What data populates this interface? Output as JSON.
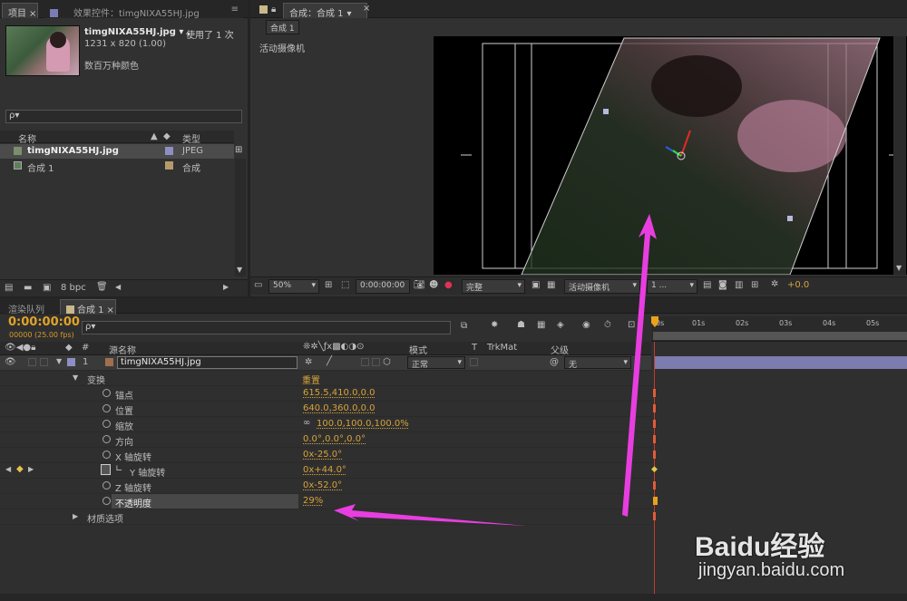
{
  "project": {
    "tabs": [
      "项目",
      "效果控件：timgNIXA55HJ.jpg"
    ],
    "asset_name": "timgNIXA55HJ.jpg ▾ ,",
    "usage": "使用了 1 次",
    "dims": "1231 x 820 (1.00)",
    "color_desc": "数百万种颜色",
    "search_placeholder": "ρ▾",
    "columns": {
      "name": "名称",
      "type": "类型"
    },
    "items": [
      {
        "name": "timgNIXA55HJ.jpg",
        "type": "JPEG",
        "swatch": "#8e8ec4"
      },
      {
        "name": "合成 1",
        "type": "合成",
        "swatch": "#b49a6a"
      }
    ],
    "bpc": "8 bpc"
  },
  "viewer": {
    "tab": "合成：合成 1",
    "subtab": "合成 1",
    "camera_label": "活动摄像机",
    "toolbar": {
      "zoom": "50%",
      "timecode": "0:00:00:00",
      "quality": "完整",
      "view": "活动摄像机",
      "layout": "1 ...",
      "exposure": "+0.0"
    }
  },
  "timeline": {
    "tabs": [
      "渲染队列",
      "合成 1"
    ],
    "timecode": "0:00:00:00",
    "fps": "00000 (25.00 fps)",
    "search_placeholder": "ρ▾",
    "headers": {
      "hash": "#",
      "source": "源名称",
      "mode": "模式",
      "t": "T",
      "trkmat": "TrkMat",
      "parent": "父级"
    },
    "layer": {
      "num": "1",
      "name": "timgNIXA55HJ.jpg",
      "mode": "正常",
      "parent": "无"
    },
    "transform_label": "变换",
    "reset_label": "重置",
    "props": [
      {
        "name": "锚点",
        "value": "615.5,410.0,0.0"
      },
      {
        "name": "位置",
        "value": "640.0,360.0,0.0"
      },
      {
        "name": "缩放",
        "value": "100.0,100.0,100.0%"
      },
      {
        "name": "方向",
        "value": "0.0°,0.0°,0.0°"
      },
      {
        "name": "X 轴旋转",
        "value": "0x-25.0°"
      },
      {
        "name": "Y 轴旋转",
        "value": "0x+44.0°"
      },
      {
        "name": "Z 轴旋转",
        "value": "0x-52.0°"
      },
      {
        "name": "不透明度",
        "value": "29%"
      }
    ],
    "material_label": "材质选项",
    "ruler": [
      "0s",
      "01s",
      "02s",
      "03s",
      "04s",
      "05s"
    ]
  },
  "watermark": {
    "brand": "Baidu经验",
    "url": "jingyan.baidu.com"
  },
  "colors": {
    "accent": "#d8a33a",
    "annotation_arrow": "#e83ee0",
    "layer_bar": "#8a8ac6"
  }
}
